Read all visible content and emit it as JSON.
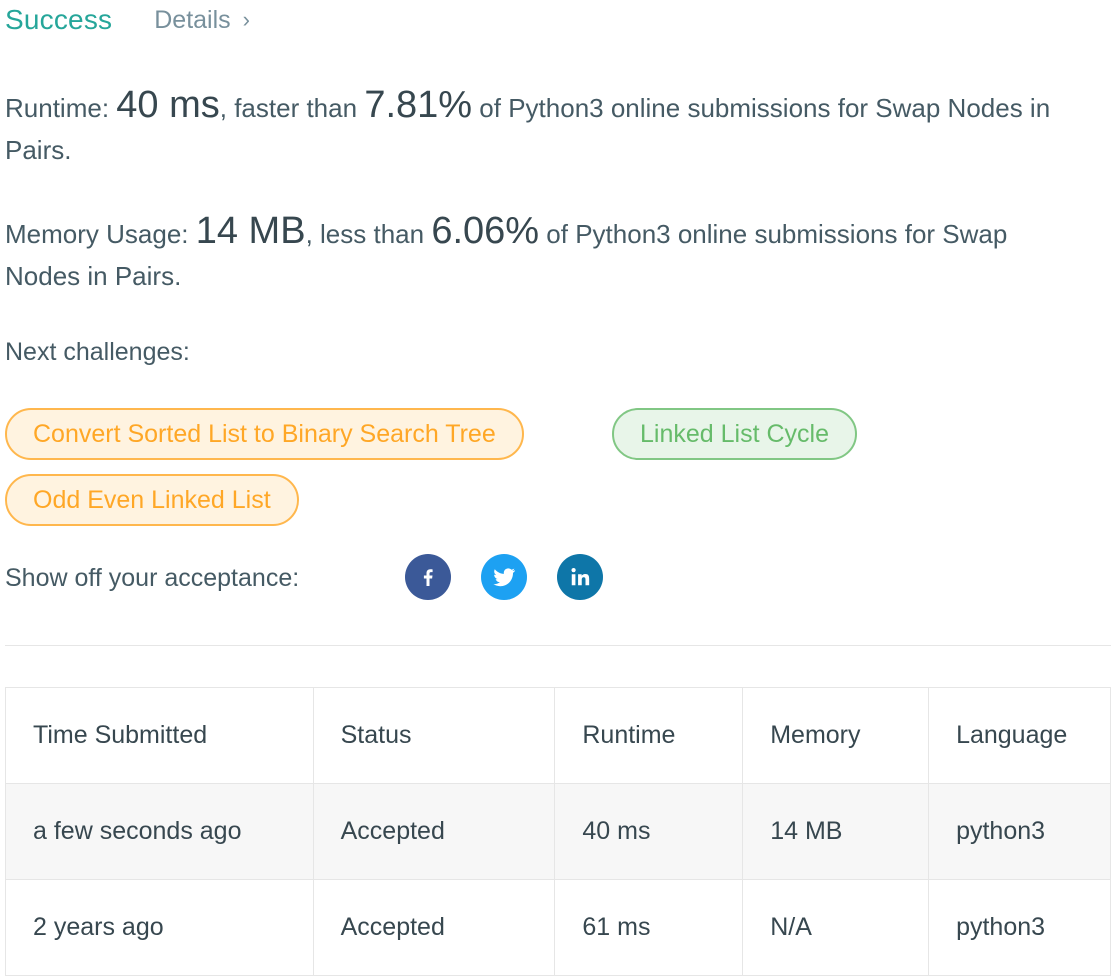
{
  "header": {
    "status": "Success",
    "details_label": "Details",
    "details_icon": "chevron-right-icon"
  },
  "runtime": {
    "label": "Runtime:",
    "value": "40 ms",
    "comparison": ", faster than",
    "percent": "7.81%",
    "suffix": "of Python3 online submissions for Swap Nodes in Pairs."
  },
  "memory": {
    "label": "Memory Usage:",
    "value": "14 MB",
    "comparison": ", less than",
    "percent": "6.06%",
    "suffix": "of Python3 online submissions for Swap Nodes in Pairs."
  },
  "next_challenges": {
    "label": "Next challenges:",
    "items": [
      {
        "label": "Convert Sorted List to Binary Search Tree",
        "color": "#ffa726"
      },
      {
        "label": "Linked List Cycle",
        "color": "#66bb6a"
      },
      {
        "label": "Odd Even Linked List",
        "color": "#ffa726"
      }
    ]
  },
  "share": {
    "label": "Show off your acceptance:",
    "icons": [
      "facebook-icon",
      "twitter-icon",
      "linkedin-icon"
    ]
  },
  "table": {
    "headers": [
      "Time Submitted",
      "Status",
      "Runtime",
      "Memory",
      "Language"
    ],
    "rows": [
      [
        "a few seconds ago",
        "Accepted",
        "40 ms",
        "14 MB",
        "python3"
      ],
      [
        "2 years ago",
        "Accepted",
        "61 ms",
        "N/A",
        "python3"
      ]
    ]
  },
  "colors": {
    "accent": "#26a69a",
    "orange": "#ffa726",
    "green": "#66bb6a"
  }
}
